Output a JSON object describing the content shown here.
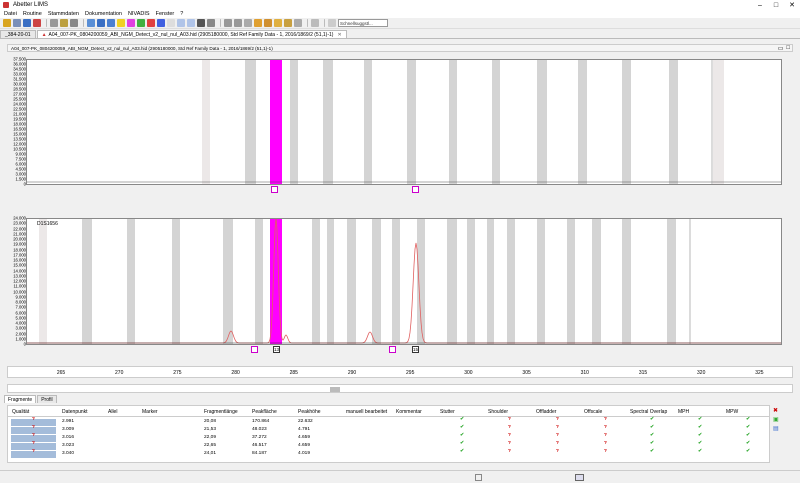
{
  "window": {
    "title": "Abetter LIMS"
  },
  "menu": [
    "Datei",
    "Routine",
    "Stammdaten",
    "Dokumentation",
    "NIVADIS",
    "Fenster",
    "?"
  ],
  "toolbar": {
    "search_placeholder": "Schnellsuggstl..."
  },
  "tabs": [
    {
      "label": "_384-20-01"
    },
    {
      "label": "A04_007-PK_0804200059_ABI_NGM_Detect_v2_nul_nul_A03.hid (2905180000, Std Ref Family Data - 1, 2016/1869/2 (51,1)-1)"
    }
  ],
  "panel": {
    "title": "A04_007-PK_0804200059_ABI_NGM_Detect_v2_nul_nul_A03.hid (2905180000, Std Ref Family Data - 1, 2016/1869/2 (51,1)-1)"
  },
  "plot_top": {
    "ylabels": [
      "37.500",
      "36.000",
      "34.500",
      "33.000",
      "31.500",
      "30.000",
      "28.500",
      "27.000",
      "25.500",
      "24.000",
      "22.500",
      "21.000",
      "19.500",
      "18.000",
      "16.500",
      "15.000",
      "13.500",
      "12.000",
      "10.500",
      "9.000",
      "7.500",
      "6.000",
      "4.500",
      "3.000",
      "1.500",
      "0"
    ],
    "markers": [
      "",
      ""
    ]
  },
  "plot_bottom": {
    "label": "D1S1656",
    "ylabels": [
      "24.000",
      "23.000",
      "22.000",
      "21.000",
      "20.000",
      "19.000",
      "18.000",
      "17.000",
      "16.000",
      "15.000",
      "14.000",
      "13.000",
      "12.000",
      "11.000",
      "10.000",
      "9.000",
      "8.000",
      "7.000",
      "6.000",
      "5.000",
      "4.000",
      "3.000",
      "2.000",
      "1.000",
      "0"
    ],
    "markers": [
      "",
      "13",
      "",
      "15"
    ]
  },
  "xaxis": [
    "265",
    "270",
    "275",
    "280",
    "285",
    "290",
    "295",
    "300",
    "305",
    "310",
    "315",
    "320",
    "325"
  ],
  "bottom_tabs": [
    "Fragmente",
    "Profil"
  ],
  "table": {
    "headers": [
      "Qualität",
      "Datenpunkt",
      "Allel",
      "Marker",
      "Fragmentlänge",
      "Peakfläche",
      "Peakhöhe",
      "manuell bearbeitet",
      "Kommentar",
      "Stutter",
      "Shoulder",
      "Offladder",
      "Offscale",
      "Spectral Overlap",
      "MPH",
      "MPW"
    ],
    "rows": [
      {
        "datenpunkt": "2.991",
        "fragment": "20,08",
        "flaeche": "170.864",
        "hoehe": "22.632",
        "flags": [
          "check",
          "q",
          "q",
          "q",
          "check",
          "check",
          "check"
        ]
      },
      {
        "datenpunkt": "3.009",
        "fragment": "21,53",
        "flaeche": "48.023",
        "hoehe": "4.791",
        "flags": [
          "check",
          "q",
          "q",
          "q",
          "check",
          "check",
          "check"
        ]
      },
      {
        "datenpunkt": "3.016",
        "fragment": "22,09",
        "flaeche": "37.272",
        "hoehe": "4.659",
        "flags": [
          "check",
          "q",
          "q",
          "q",
          "check",
          "check",
          "check"
        ]
      },
      {
        "datenpunkt": "3.023",
        "fragment": "22,65",
        "flaeche": "46.517",
        "hoehe": "4.659",
        "flags": [
          "check",
          "q",
          "q",
          "q",
          "check",
          "check",
          "check"
        ]
      },
      {
        "datenpunkt": "3.040",
        "fragment": "24,01",
        "flaeche": "84.187",
        "hoehe": "4.019",
        "flags": [
          "check",
          "q",
          "q",
          "q",
          "check",
          "check",
          "check"
        ]
      }
    ]
  },
  "colors": {
    "magenta": "#ff00ff",
    "trace": "#e06060",
    "bin": "#d4d4d4",
    "qcell": "#a4bcda"
  }
}
